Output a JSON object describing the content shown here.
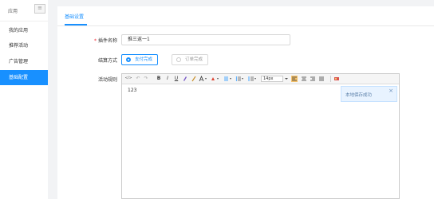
{
  "sidebar": {
    "title": "应用",
    "menu_icon": "≡",
    "items": [
      {
        "label": "我的应用"
      },
      {
        "label": "推荐活动"
      },
      {
        "label": "广告管理"
      },
      {
        "label": "基础配置"
      }
    ]
  },
  "tabs": [
    {
      "label": "基础设置"
    }
  ],
  "form": {
    "plugin_name_label": "插件名称",
    "plugin_name_value": "推三返一1",
    "settlement_label": "结算方式",
    "settlement_options": [
      {
        "label": "支付完成",
        "checked": true
      },
      {
        "label": "订单完成",
        "checked": false
      }
    ],
    "rules_label": "活动规则"
  },
  "editor": {
    "toolbar": {
      "source": "</>",
      "undo": "↶",
      "redo": "↷",
      "bold": "B",
      "italic": "I",
      "underline": "U",
      "font_size": "14px"
    },
    "content": "123"
  },
  "toast": {
    "text": "本地保存成功",
    "close": "×"
  },
  "colors": {
    "accent": "#1890ff"
  }
}
